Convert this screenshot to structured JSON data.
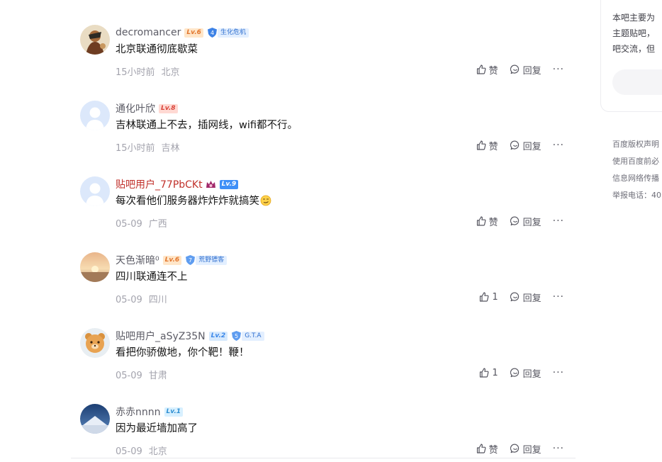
{
  "comments": [
    {
      "username": "decromancer",
      "level": "Lv.6",
      "badge_num": "4",
      "badge_text": "生化危机",
      "content": "北京联通彻底歇菜",
      "time": "15小时前",
      "location": "北京",
      "like_label": "赞",
      "reply_label": "回复",
      "more_label": "···"
    },
    {
      "username": "通化叶欣",
      "level": "Lv.8",
      "content": "吉林联通上不去，插网线，wifi都不行。",
      "time": "15小时前",
      "location": "吉林",
      "like_label": "赞",
      "reply_label": "回复",
      "more_label": "···"
    },
    {
      "username": "贴吧用户_77PbCKt",
      "level": "Lv.9",
      "content": "每次看他们服务器炸炸炸就搞笑",
      "emoji": "smirk-emoji",
      "time": "05-09",
      "location": "广西",
      "like_label": "赞",
      "reply_label": "回复",
      "more_label": "···"
    },
    {
      "username": "天色渐暗⁰",
      "level": "Lv.6",
      "badge_num": "7",
      "badge_text": "荒野镖客",
      "content": "四川联通连不上",
      "time": "05-09",
      "location": "四川",
      "like_label": "1",
      "reply_label": "回复",
      "more_label": "···"
    },
    {
      "username": "贴吧用户_aSyZ35N",
      "level": "Lv.2",
      "badge_num": "5",
      "badge_text": "G.T.A",
      "content": "看把你骄傲地，你个靶！鞭！",
      "time": "05-09",
      "location": "甘肃",
      "like_label": "1",
      "reply_label": "回复",
      "more_label": "···"
    },
    {
      "username": "赤赤nnnn",
      "level": "Lv.1",
      "content": "因为最近墙加高了",
      "time": "05-09",
      "location": "北京",
      "like_label": "赞",
      "reply_label": "回复",
      "more_label": "···"
    }
  ],
  "sidebar": {
    "intro_lines": [
      "本吧主要为",
      "主题贴吧，",
      "吧交流，但"
    ]
  },
  "footer": {
    "lines": [
      "百度版权声明",
      "使用百度前必",
      "信息网络传播",
      "举报电话：40"
    ]
  },
  "colors": {
    "vip_name": "#c1312b",
    "level_orange": "#e2762d",
    "level_blue": "#3e8ff7",
    "meta_gray": "#a3a3ad"
  },
  "icons": {
    "like": "thumbs-up-icon",
    "reply": "reply-bubble-icon",
    "more": "more-dots-icon",
    "badge": "shield-badge-icon",
    "vip": "crown-icon"
  }
}
